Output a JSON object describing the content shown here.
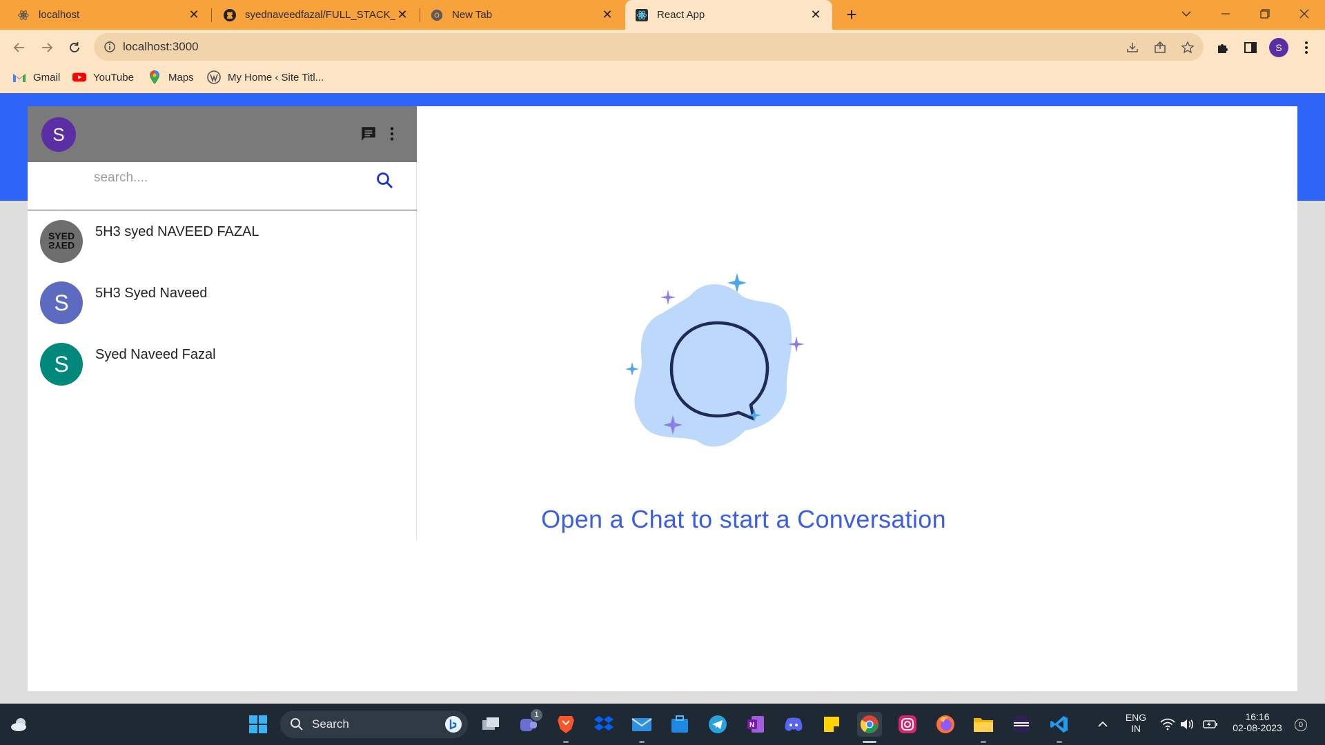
{
  "browser": {
    "tabs": [
      {
        "title": "localhost",
        "icon": "react-icon"
      },
      {
        "title": "syednaveedfazal/FULL_STACK_CH",
        "icon": "github-icon"
      },
      {
        "title": "New Tab",
        "icon": "chrome-icon"
      },
      {
        "title": "React App",
        "icon": "react-icon",
        "active": true
      }
    ],
    "address": "localhost:3000",
    "profile_initial": "S",
    "bookmarks": [
      {
        "label": "Gmail",
        "icon": "gmail-icon"
      },
      {
        "label": "YouTube",
        "icon": "youtube-icon"
      },
      {
        "label": "Maps",
        "icon": "maps-icon"
      },
      {
        "label": "My Home ‹ Site Titl...",
        "icon": "wordpress-icon"
      }
    ]
  },
  "app": {
    "user_initial": "S",
    "search_placeholder": "search....",
    "chats": [
      {
        "name": "5H3 syed NAVEED FAZAL",
        "avatar_text": "SYED",
        "avatar_color": "#6e6e6e"
      },
      {
        "name": "5H3 Syed Naveed",
        "avatar_text": "S",
        "avatar_color": "#5c6bc0"
      },
      {
        "name": "Syed Naveed Fazal",
        "avatar_text": "S",
        "avatar_color": "#00897b"
      }
    ],
    "empty_state": "Open a Chat to start a Conversation"
  },
  "taskbar": {
    "search_label": "Search",
    "teams_badge": "1",
    "lang": "ENG",
    "region": "IN",
    "time": "16:16",
    "date": "02-08-2023",
    "notifications": "0"
  },
  "colors": {
    "accent": "#2f64f9",
    "chrome": "#f8a23c",
    "header": "#7a7a7a",
    "cta": "#3a5ee8"
  }
}
